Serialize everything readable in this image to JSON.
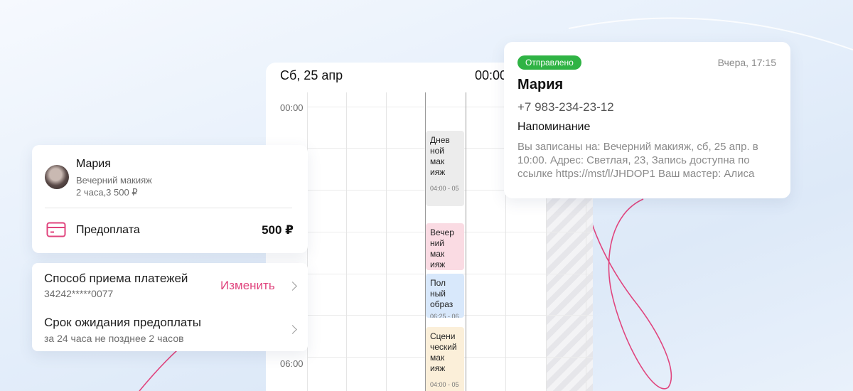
{
  "calendar": {
    "date": "Сб, 25 апр",
    "time_top": "00:00",
    "times": [
      "00:00",
      "06:00"
    ],
    "events": [
      {
        "lines": [
          "Днев",
          "ной",
          "мак",
          "ияж"
        ],
        "time": "04:00 - 05",
        "color": "grey"
      },
      {
        "lines": [
          "Вечер",
          "ний",
          "мак",
          "ияж"
        ],
        "time": "",
        "color": "pink"
      },
      {
        "lines": [
          "Пол",
          "ный",
          "образ"
        ],
        "time": "06:25 - 06",
        "color": "blue"
      },
      {
        "lines": [
          "Сцени",
          "ческий",
          "мак",
          "ияж"
        ],
        "time": "04:00 - 05",
        "color": "beige"
      }
    ]
  },
  "booking": {
    "client_name": "Мария",
    "service": "Вечерний макияж",
    "duration_price": "2 часа,3 500 ₽",
    "prepayment_label": "Предоплата",
    "prepayment_value": "500 ₽"
  },
  "payment": {
    "method_title": "Способ приема платежей",
    "method_card": "34242*****0077",
    "change_label": "Изменить",
    "wait_title": "Срок ожидания предоплаты",
    "wait_sub": "за 24 часа не позднее 2 часов"
  },
  "notification": {
    "status": "Отправлено",
    "time": "Вчера, 17:15",
    "name": "Мария",
    "phone": "+7 983-234-23-12",
    "type": "Напоминание",
    "message": "Вы записаны на: Вечерний макияж, сб, 25 апр. в 10:00. Адрес: Светлая, 23, Запись доступна по ссылке https://mst/l/JHDOP1 Ваш мастер: Алиса"
  },
  "colors": {
    "accent": "#e0457e",
    "success": "#2fb344"
  }
}
